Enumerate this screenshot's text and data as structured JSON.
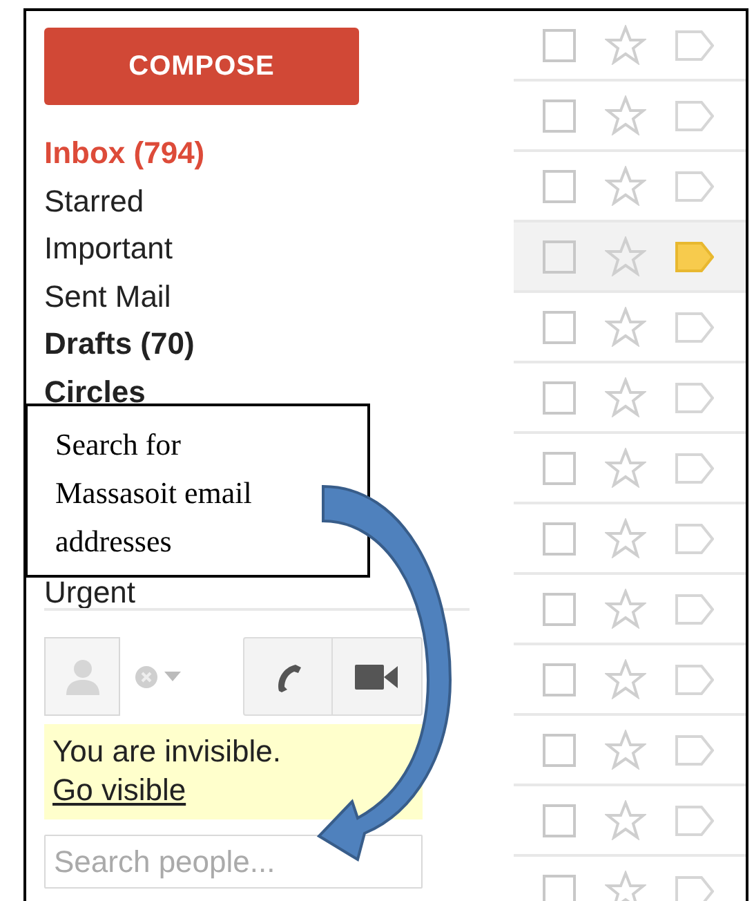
{
  "compose": {
    "label": "COMPOSE"
  },
  "nav": {
    "items": [
      {
        "label": "Inbox (794)",
        "selected": true,
        "unread": true
      },
      {
        "label": "Starred",
        "selected": false,
        "unread": false
      },
      {
        "label": "Important",
        "selected": false,
        "unread": false
      },
      {
        "label": "Sent Mail",
        "selected": false,
        "unread": false
      },
      {
        "label": "Drafts (70)",
        "selected": false,
        "unread": true
      },
      {
        "label": "Circles",
        "selected": false,
        "unread": true
      },
      {
        "label": "Urgent",
        "selected": false,
        "unread": false
      }
    ]
  },
  "chat": {
    "notice": {
      "text": "You are invisible.",
      "link": "Go visible"
    },
    "search": {
      "placeholder": "Search people..."
    }
  },
  "callout": {
    "lines": [
      "Search for",
      "Massasoit email",
      "addresses"
    ]
  },
  "rows": [
    {
      "read": false,
      "important": false
    },
    {
      "read": false,
      "important": false
    },
    {
      "read": false,
      "important": false
    },
    {
      "read": true,
      "important": true
    },
    {
      "read": false,
      "important": false
    },
    {
      "read": false,
      "important": false
    },
    {
      "read": false,
      "important": false
    },
    {
      "read": false,
      "important": false
    },
    {
      "read": false,
      "important": false
    },
    {
      "read": false,
      "important": false
    },
    {
      "read": false,
      "important": false
    },
    {
      "read": false,
      "important": false
    },
    {
      "read": false,
      "important": false
    }
  ]
}
